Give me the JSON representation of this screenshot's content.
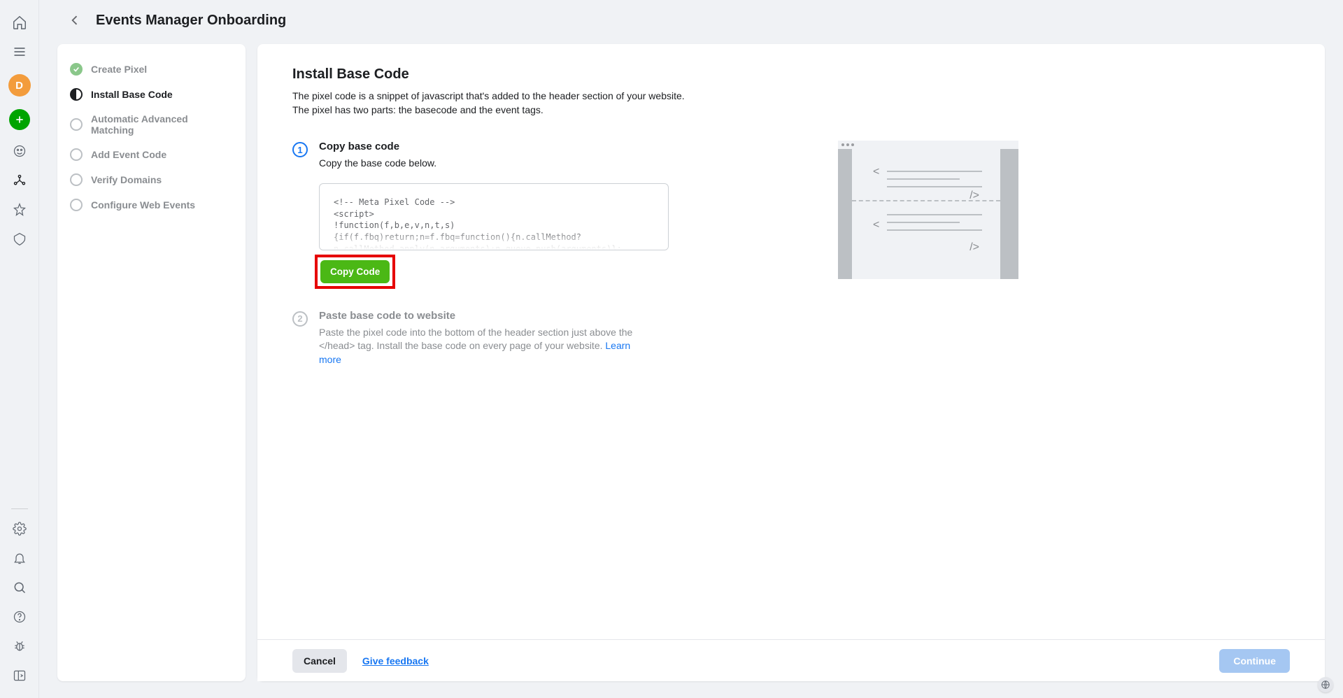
{
  "header": {
    "title": "Events Manager Onboarding"
  },
  "avatar_letter": "D",
  "steps_panel": [
    {
      "label": "Create Pixel",
      "status": "done"
    },
    {
      "label": "Install Base Code",
      "status": "current"
    },
    {
      "label": "Automatic Advanced Matching",
      "status": "pending"
    },
    {
      "label": "Add Event Code",
      "status": "pending"
    },
    {
      "label": "Verify Domains",
      "status": "pending"
    },
    {
      "label": "Configure Web Events",
      "status": "pending"
    }
  ],
  "main": {
    "title": "Install Base Code",
    "desc1": "The pixel code is a snippet of javascript that's added to the header section of your website.",
    "desc2": "The pixel has two parts: the basecode and the event tags.",
    "step1": {
      "num": "1",
      "title": "Copy base code",
      "sub": "Copy the base code below.",
      "code": "<!-- Meta Pixel Code -->\n<script>\n!function(f,b,e,v,n,t,s)\n{if(f.fbq)return;n=f.fbq=function(){n.callMethod?\nn.callMethod.apply(n,arguments):n.queue.push(arguments)};",
      "copy_btn": "Copy Code"
    },
    "step2": {
      "num": "2",
      "title": "Paste base code to website",
      "sub": "Paste the pixel code into the bottom of the header section just above the </head> tag. Install the base code on every page of your website. ",
      "learn": "Learn more"
    }
  },
  "footer": {
    "cancel": "Cancel",
    "feedback": "Give feedback",
    "continue": "Continue"
  }
}
